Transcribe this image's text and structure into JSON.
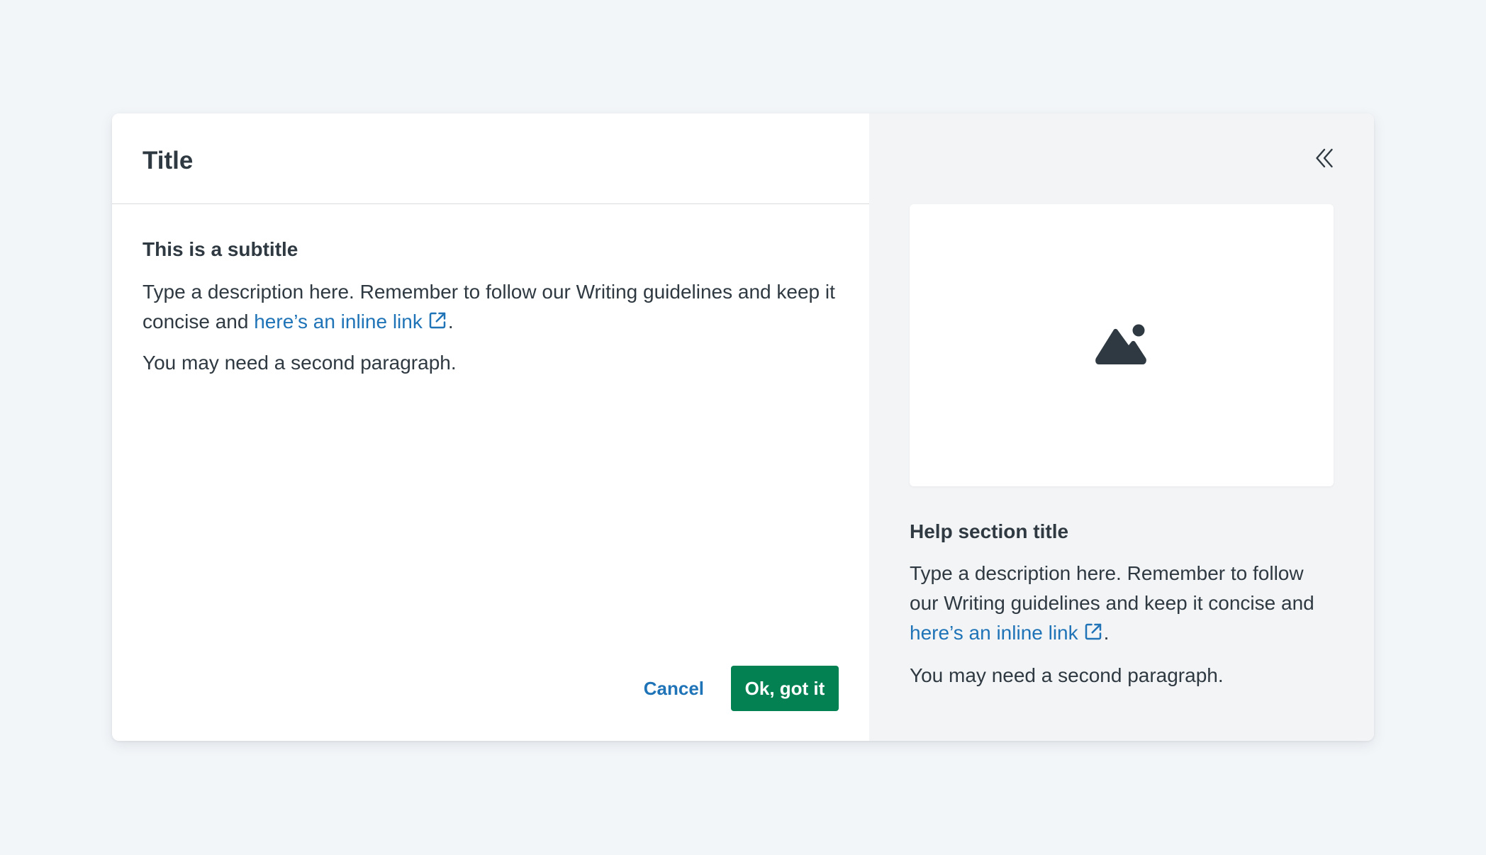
{
  "modal": {
    "title": "Title",
    "subtitle": "This is a subtitle",
    "description_before_link": "Type a description here. Remember to follow our Writing guidelines and keep it concise and ",
    "link_text": "here’s an inline link",
    "description_after_link": ".",
    "second_paragraph": "You may need a second paragraph.",
    "cancel_label": "Cancel",
    "confirm_label": "Ok, got it"
  },
  "help": {
    "collapse_icon": "chevrons-left-icon",
    "image_icon": "image-placeholder-icon",
    "title": "Help section title",
    "description_before_link": "Type a description here. Remember to follow our Writing guidelines and keep it concise and ",
    "link_text": "here’s an inline link",
    "description_after_link": ".",
    "second_paragraph": "You may need a second paragraph."
  },
  "colors": {
    "page_background": "#f3f6f9",
    "text": "#2f3941",
    "link": "#1f73b7",
    "primary_button": "#038153",
    "aside_background": "#f3f4f6"
  }
}
